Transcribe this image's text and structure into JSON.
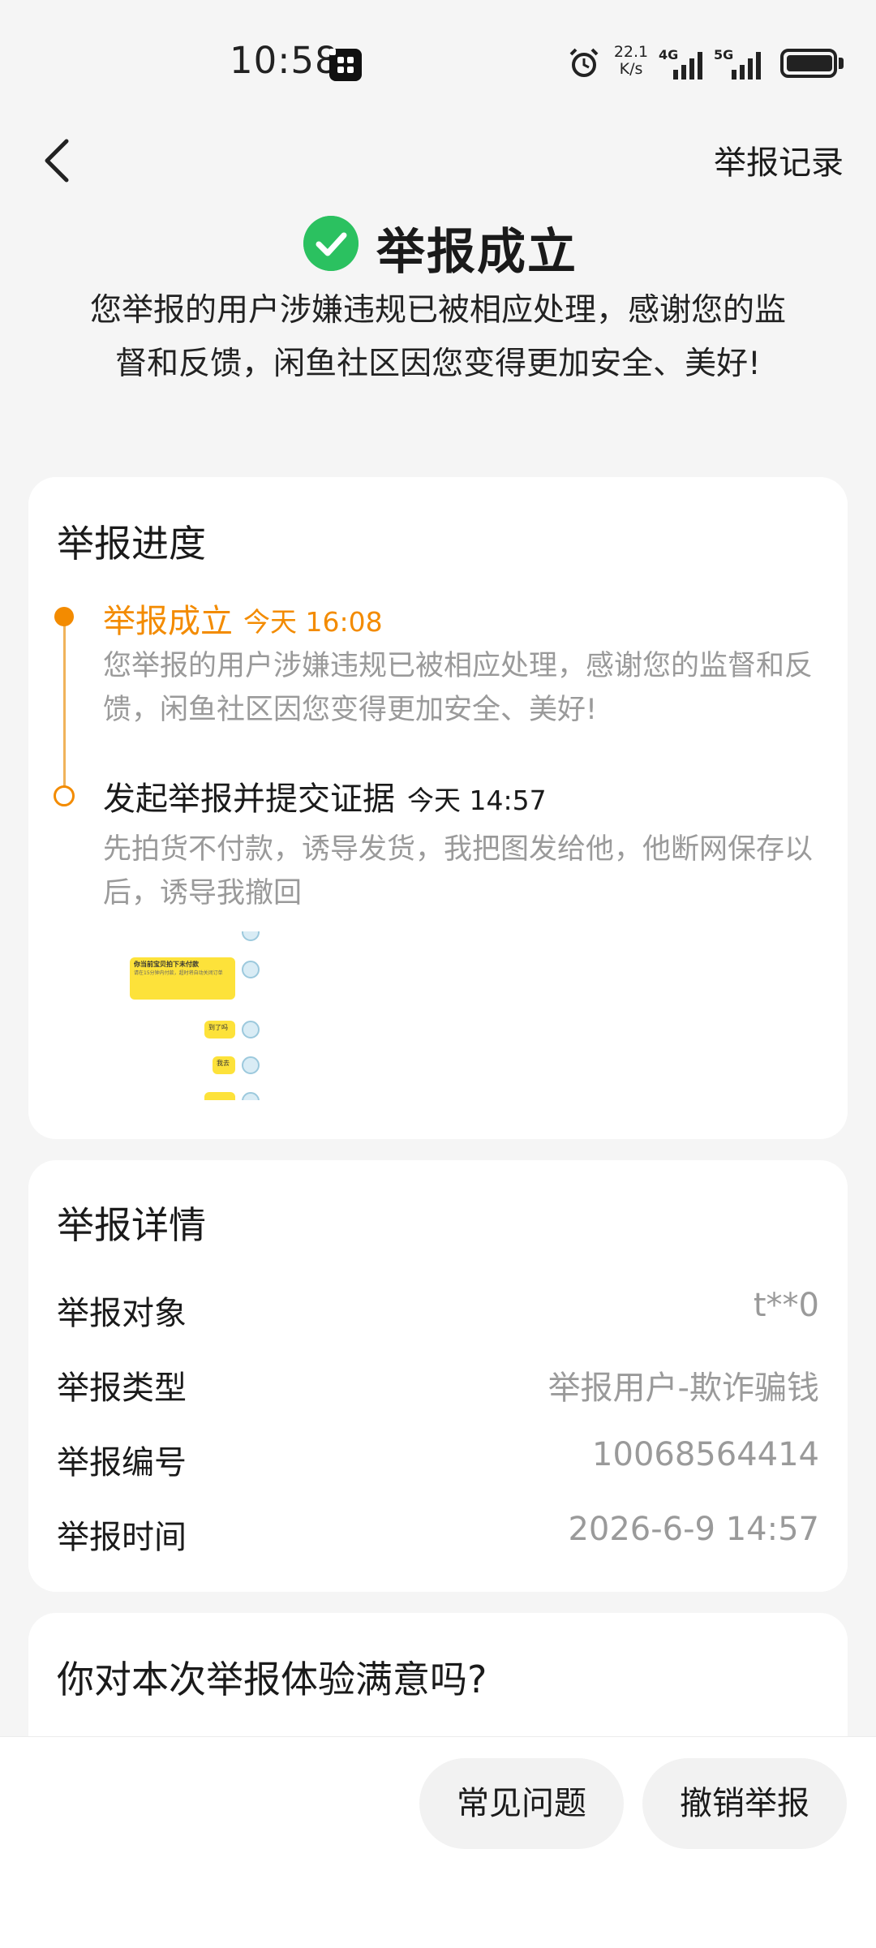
{
  "status_bar": {
    "time": "10:58",
    "net_speed_top": "22.1",
    "net_speed_bottom": "K/s",
    "signal_1": "4G",
    "signal_2": "5G"
  },
  "nav": {
    "records_label": "举报记录"
  },
  "hero": {
    "title": "举报成立",
    "description": "您举报的用户涉嫌违规已被相应处理，感谢您的监督和反馈，闲鱼社区因您变得更加安全、美好!"
  },
  "progress": {
    "title": "举报进度",
    "steps": [
      {
        "title": "举报成立",
        "time": "今天 16:08",
        "body": "您举报的用户涉嫌违规已被相应处理，感谢您的监督和反馈，闲鱼社区因您变得更加安全、美好!"
      },
      {
        "title": "发起举报并提交证据",
        "time": "今天 14:57",
        "body": "先拍货不付款，诱导发货，我把图发给他，他断网保存以后，诱导我撤回"
      }
    ],
    "evidence_chat": {
      "bubble_1_title": "你当前宝贝拍下未付款",
      "bubble_1_body": "请在15分钟内付款，超时将自动关闭订单",
      "bubble_2": "到了吗",
      "bubble_3": "我去"
    }
  },
  "details": {
    "title": "举报详情",
    "rows": [
      {
        "label": "举报对象",
        "value": "t**0"
      },
      {
        "label": "举报类型",
        "value": "举报用户-欺诈骗钱"
      },
      {
        "label": "举报编号",
        "value": "10068564414"
      },
      {
        "label": "举报时间",
        "value": "2026-6-9 14:57"
      }
    ]
  },
  "survey": {
    "title": "你对本次举报体验满意吗?"
  },
  "bottom": {
    "faq_label": "常见问题",
    "revoke_label": "撤销举报"
  },
  "colors": {
    "accent_orange": "#f38b00",
    "success_green": "#2bc160",
    "muted_text": "#9a9a9a"
  }
}
